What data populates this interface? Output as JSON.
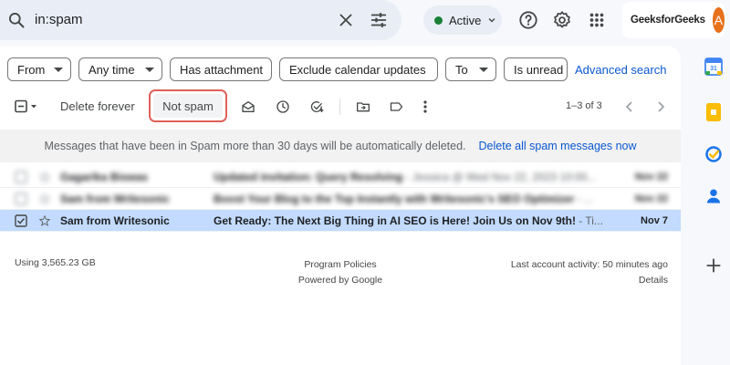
{
  "search": {
    "query": "in:spam"
  },
  "status": {
    "label": "Active",
    "color": "#188038"
  },
  "account": {
    "brand": "GeeksforGeeks",
    "avatar_letter": "A",
    "avatar_color": "#e8711c"
  },
  "filters": {
    "chips": [
      "From",
      "Any time",
      "Has attachment",
      "Exclude calendar updates",
      "To",
      "Is unread"
    ],
    "advanced_search": "Advanced search"
  },
  "toolbar": {
    "delete_forever": "Delete forever",
    "not_spam": "Not spam",
    "pagination": "1–3 of 3"
  },
  "banner": {
    "message": "Messages that have been in Spam more than 30 days will be automatically deleted.",
    "action": "Delete all spam messages now"
  },
  "emails": [
    {
      "sender": "Gagarika Biswas",
      "subject": "Updated invitation: Query Resolving",
      "snippet": " - Jessica @ Wed Nov 22, 2023 10:00...",
      "date": "Nov 22",
      "blurred": true,
      "selected": false
    },
    {
      "sender": "Sam from Writesonic",
      "subject": "Boost Your Blog to the Top Instantly with Writesonic's SEO Optimizer",
      "snippet": " - ...",
      "date": "Nov 22",
      "blurred": true,
      "selected": false
    },
    {
      "sender": "Sam from Writesonic",
      "subject": "Get Ready: The Next Big Thing in AI SEO is Here! Join Us on Nov 9th!",
      "snippet": " - Ti...",
      "date": "Nov 7",
      "blurred": false,
      "selected": true
    }
  ],
  "footer": {
    "storage": "Using 3,565.23 GB",
    "program_policies": "Program Policies",
    "powered_by": "Powered by Google",
    "last_activity": "Last account activity: 50 minutes ago",
    "details": "Details"
  },
  "colors": {
    "accent_link": "#0b57d0",
    "highlight_border": "#e0605a",
    "selected_row": "#c2dbff"
  }
}
